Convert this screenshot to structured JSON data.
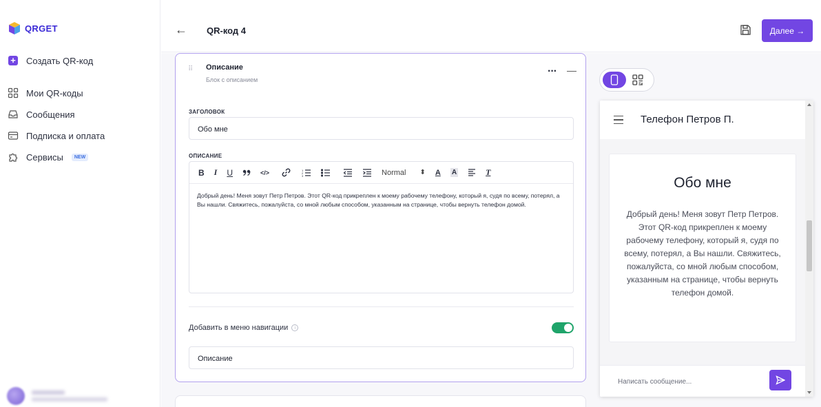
{
  "brand": {
    "name": "QRGET",
    "accent": "#7246e3"
  },
  "sidebar": {
    "create": "Создать QR-код",
    "items": [
      {
        "label": "Мои QR-коды",
        "icon": "qr-grid-icon"
      },
      {
        "label": "Сообщения",
        "icon": "inbox-icon"
      },
      {
        "label": "Подписка и оплата",
        "icon": "card-icon"
      },
      {
        "label": "Сервисы",
        "icon": "puzzle-icon",
        "badge": "NEW"
      }
    ]
  },
  "header": {
    "title": "QR-код 4",
    "next_label": "Далее →"
  },
  "block": {
    "title": "Описание",
    "subtitle": "Блок с описанием",
    "more": "···",
    "collapse": "—",
    "heading_label": "ЗАГОЛОВОК",
    "heading_value": "Обо мне",
    "description_label": "ОПИСАНИЕ",
    "toolbar": {
      "bold": "B",
      "italic": "I",
      "underline": "U",
      "quote": "❞",
      "code": "‹/›",
      "link": "🔗",
      "ol": "☰",
      "ul": "☰",
      "outdent": "⇤",
      "indent": "⇥",
      "format": "Normal",
      "format_arrow": "⇕",
      "color": "A",
      "bg": "A",
      "align": "☰",
      "clear": "T"
    },
    "description_text": "Добрый день! Меня зовут Петр Петров. Этот QR-код прикреплен к моему рабочему телефону, который я, судя по всему, потерял, а Вы нашли. Свяжитесь, пожалуйста, со мной любым способом, указанным на странице, чтобы вернуть телефон домой.",
    "nav_label": "Добавить в меню навигации",
    "nav_enabled": true,
    "nav_value": "Описание"
  },
  "preview": {
    "phone_title": "Телефон Петров П.",
    "about_title": "Обо мне",
    "about_text": "Добрый день! Меня зовут Петр Петров. Этот QR-код прикреплен к моему рабочему телефону, который я, судя по всему, потерял, а Вы нашли. Свяжитесь, пожалуйста, со мной любым способом, указанным на странице, чтобы вернуть телефон домой.",
    "message_placeholder": "Написать сообщение..."
  }
}
